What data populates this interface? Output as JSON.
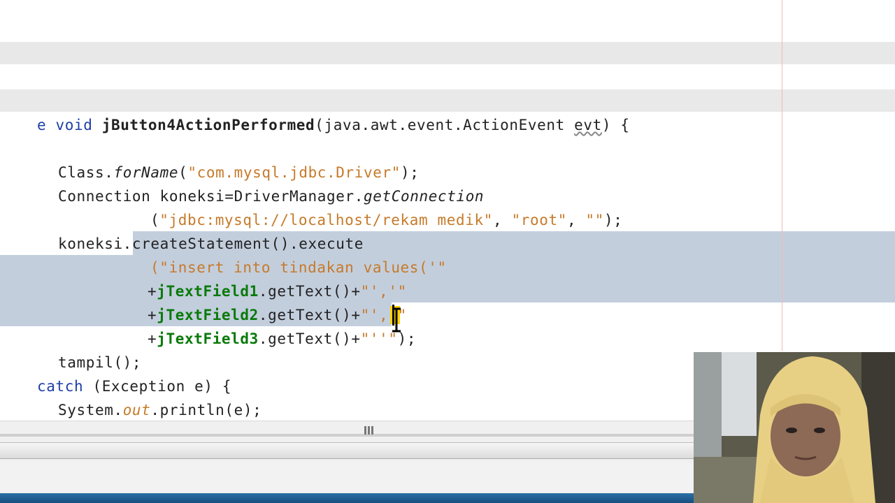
{
  "editor": {
    "lines": [
      {
        "id": "method-signature",
        "parts": [
          "e ",
          "void ",
          "jButton4ActionPerformed",
          "(java.awt.event.ActionEvent ",
          "evt",
          ") {"
        ]
      },
      {
        "id": "class-forname",
        "parts": [
          "Class.",
          "forName",
          "(",
          "\"com.mysql.jdbc.Driver\"",
          ");"
        ]
      },
      {
        "id": "connection-decl",
        "parts": [
          "Connection koneksi=DriverManager.",
          "getConnection"
        ]
      },
      {
        "id": "connection-args",
        "parts": [
          "(",
          "\"jdbc:mysql://localhost/rekam medik\"",
          ", ",
          "\"root\"",
          ", ",
          "\"\"",
          ");"
        ]
      },
      {
        "id": "create-statement",
        "parts": [
          "koneksi.createStatement().execute"
        ]
      },
      {
        "id": "insert-sql",
        "parts": [
          "(\"",
          "insert into tindakan values('\""
        ]
      },
      {
        "id": "textfield1",
        "parts": [
          "+",
          "jTextField1",
          ".getText()+",
          "\"','\""
        ]
      },
      {
        "id": "textfield2",
        "parts": [
          "+",
          "jTextField2",
          ".getText()+",
          "\"','\""
        ]
      },
      {
        "id": "textfield3",
        "parts": [
          "+",
          "jTextField3",
          ".getText()+",
          "\"'",
          "'",
          "\"",
          ");"
        ]
      },
      {
        "id": "tampil-call",
        "parts": [
          "tampil();"
        ]
      },
      {
        "id": "catch-clause",
        "parts": [
          "catch",
          " (Exception e) {"
        ]
      },
      {
        "id": "println-call",
        "parts": [
          "System.",
          "out",
          ".println(e);"
        ]
      }
    ]
  },
  "scrollbar": {
    "grip_icon": "grip-icon"
  },
  "colors": {
    "keyword": "#1f3fa8",
    "string": "#c67a2a",
    "field": "#0a7a0a",
    "selection": "#c3cedd",
    "caret_highlight": "#ffd200",
    "taskbar": "#1e5a8f"
  }
}
